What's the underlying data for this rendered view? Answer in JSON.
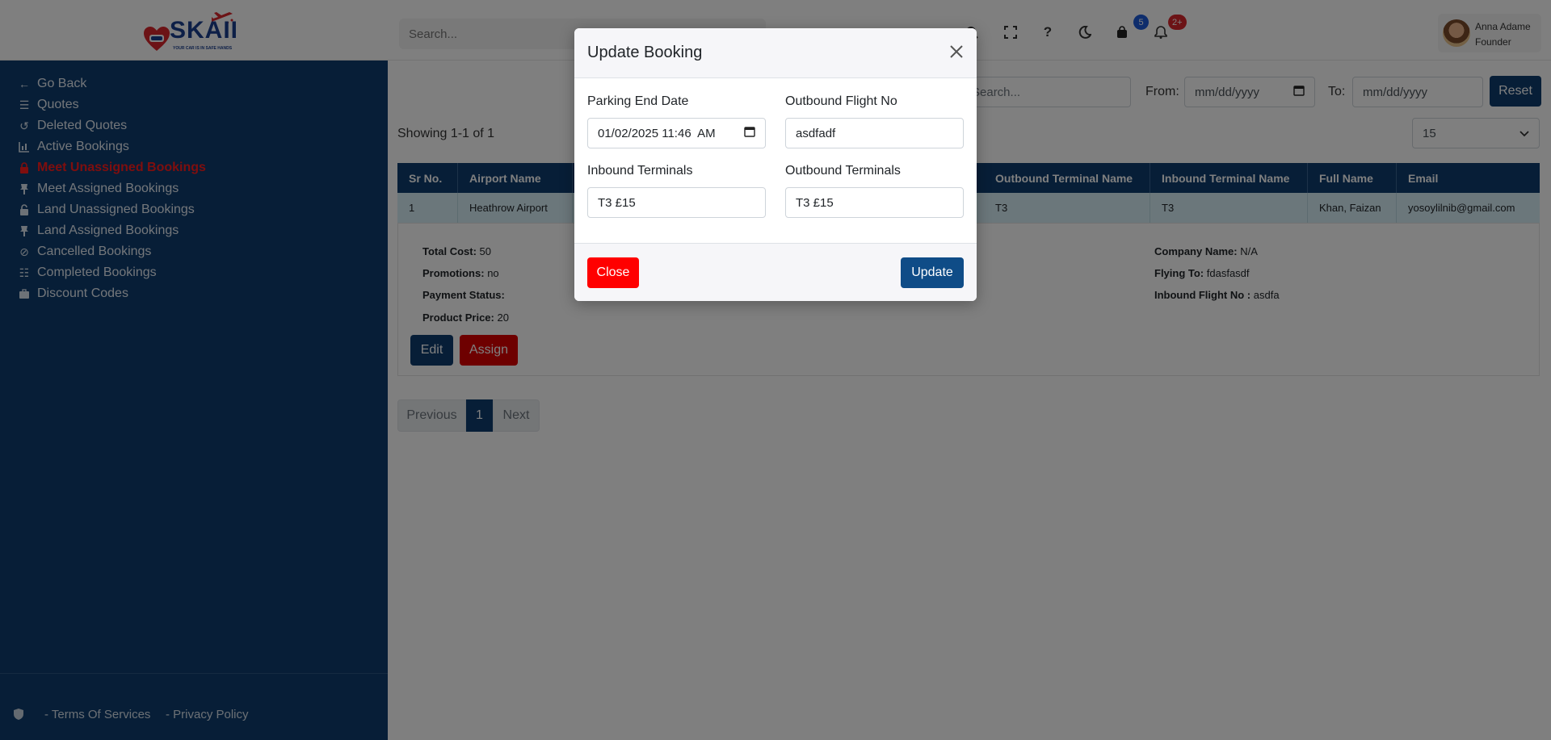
{
  "header": {
    "logo_text": "SKAII",
    "logo_tagline": "YOUR CAR IS IN SAFE HANDS",
    "search_placeholder": "Search...",
    "bag_badge": "5",
    "bell_badge": "2+",
    "user_name": "Anna Adame",
    "user_role": "Founder"
  },
  "sidebar": {
    "items": [
      {
        "label": "Go Back",
        "icon": "arrow-left-icon"
      },
      {
        "label": "Quotes",
        "icon": "list-icon"
      },
      {
        "label": "Deleted Quotes",
        "icon": "undo-icon"
      },
      {
        "label": "Active Bookings",
        "icon": "chart-icon"
      },
      {
        "label": "Meet Unassigned Bookings",
        "icon": "lock-icon"
      },
      {
        "label": "Meet Assigned Bookings",
        "icon": "pin-icon"
      },
      {
        "label": "Land Unassigned Bookings",
        "icon": "unlock-icon"
      },
      {
        "label": "Land Assigned Bookings",
        "icon": "pin-icon"
      },
      {
        "label": "Cancelled Bookings",
        "icon": "ban-icon"
      },
      {
        "label": "Completed Bookings",
        "icon": "list-check-icon"
      },
      {
        "label": "Discount Codes",
        "icon": "briefcase-icon"
      }
    ],
    "footer_terms": "- Terms Of Services",
    "footer_privacy": "- Privacy Policy"
  },
  "filters": {
    "search_placeholder": "Search...",
    "from_label": "From:",
    "from_value": "mm/dd/yyyy",
    "to_label": "To:",
    "to_value": "mm/dd/yyyy",
    "reset_label": "Reset",
    "showing": "Showing 1-1 of 1",
    "page_size": "15"
  },
  "table": {
    "headers": {
      "sr": "Sr No.",
      "airport": "Airport Name",
      "outbound_terminal": "Outbound Terminal Name",
      "inbound_terminal": "Inbound Terminal Name",
      "full_name": "Full Name",
      "email": "Email"
    },
    "row": {
      "sr": "1",
      "airport": "Heathrow Airport",
      "outbound_terminal": "T3",
      "inbound_terminal": "T3",
      "full_name": "Khan, Faizan",
      "email": "yosoylilnib@gmail.com"
    },
    "details": {
      "total_cost_label": "Total Cost:",
      "total_cost": "50",
      "promotions_label": "Promotions:",
      "promotions": "no",
      "payment_status_label": "Payment Status:",
      "payment_status": "",
      "product_price_label": "Product Price:",
      "product_price": "20",
      "company_label": "Company Name:",
      "company": "N/A",
      "flying_to_label": "Flying To:",
      "flying_to": "fdasfasdf",
      "inbound_flight_label": "Inbound Flight No :",
      "inbound_flight": "asdfa",
      "edit_label": "Edit",
      "assign_label": "Assign"
    }
  },
  "pagination": {
    "previous": "Previous",
    "current": "1",
    "next": "Next"
  },
  "modal": {
    "title": "Update Booking",
    "parking_end_label": "Parking End Date",
    "parking_end_value": "01/02/2025 11:46  AM",
    "outbound_flight_label": "Outbound Flight No",
    "outbound_flight_value": "asdfadf",
    "inbound_terminals_label": "Inbound Terminals",
    "inbound_terminals_value": "T3 £15",
    "outbound_terminals_label": "Outbound Terminals",
    "outbound_terminals_value": "T3 £15",
    "close_label": "Close",
    "update_label": "Update"
  },
  "colors": {
    "primary": "#0e3d6e",
    "danger": "#dc0000",
    "active_nav": "#ff1c1c",
    "row_highlight": "#d6eef6"
  }
}
